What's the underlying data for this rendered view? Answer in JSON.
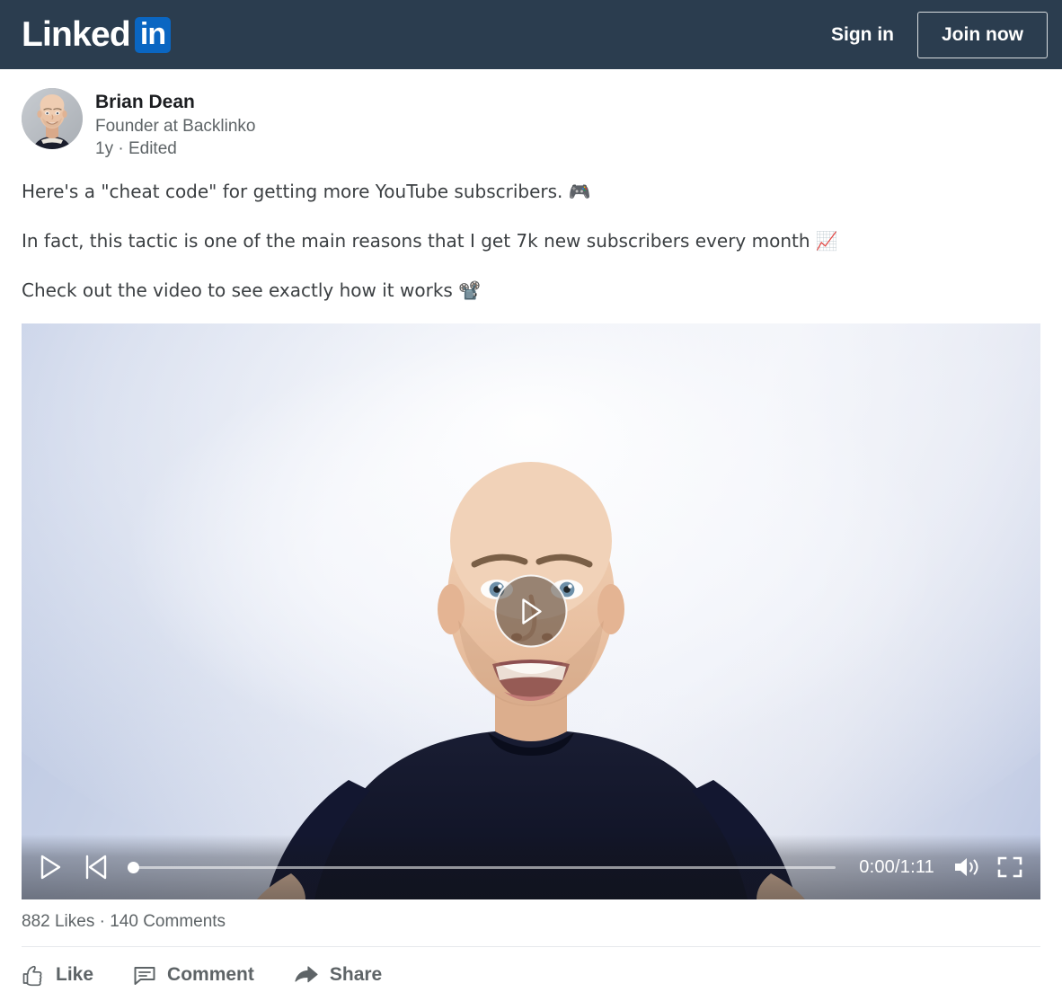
{
  "header": {
    "logo_text": "Linked",
    "logo_badge": "in",
    "signin_label": "Sign in",
    "join_label": "Join now",
    "background_color": "#2b3d4f",
    "badge_color": "#0a66c2"
  },
  "post": {
    "author": {
      "name": "Brian Dean",
      "headline": "Founder at Backlinko",
      "timestamp": "1y · Edited"
    },
    "lines": [
      "Here's a \"cheat code\" for getting more YouTube subscribers. 🎮",
      "In fact, this tactic is one of the main reasons that I get 7k new subscribers every month 📈",
      "Check out the video to see exactly how it works 📽️"
    ],
    "video": {
      "current_time": "0:00",
      "duration": "1:11",
      "timecode": "0:00/1:11",
      "progress_percent": 0
    },
    "stats": "882 Likes · 140 Comments",
    "likes_count": "882",
    "comments_count": "140",
    "actions": [
      {
        "label": "Like",
        "icon": "thumbs-up-icon"
      },
      {
        "label": "Comment",
        "icon": "comment-bubble-icon"
      },
      {
        "label": "Share",
        "icon": "share-arrow-icon"
      }
    ]
  }
}
